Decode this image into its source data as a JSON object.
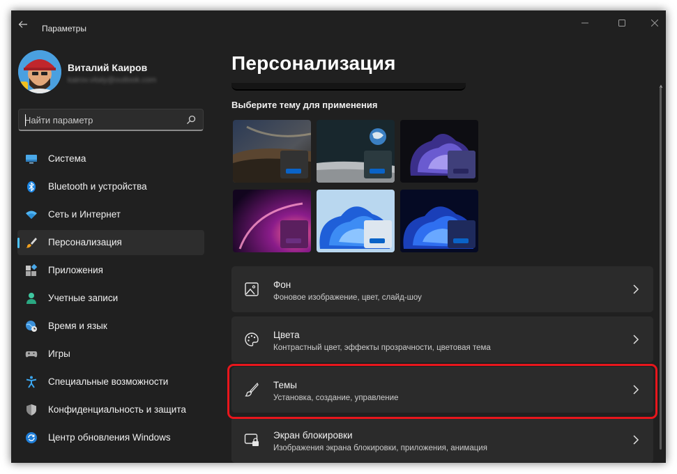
{
  "window": {
    "title": "Параметры"
  },
  "user": {
    "name": "Виталий Каиров",
    "email": "kairov.vitaly@outlook.com"
  },
  "search": {
    "placeholder": "Найти параметр"
  },
  "nav": [
    {
      "label": "Система",
      "icon": "monitor-icon"
    },
    {
      "label": "Bluetooth и устройства",
      "icon": "bluetooth-icon"
    },
    {
      "label": "Сеть и Интернет",
      "icon": "wifi-icon"
    },
    {
      "label": "Персонализация",
      "icon": "brush-icon",
      "active": true
    },
    {
      "label": "Приложения",
      "icon": "apps-icon"
    },
    {
      "label": "Учетные записи",
      "icon": "person-icon"
    },
    {
      "label": "Время и язык",
      "icon": "globe-clock-icon"
    },
    {
      "label": "Игры",
      "icon": "gamepad-icon"
    },
    {
      "label": "Специальные возможности",
      "icon": "accessibility-icon"
    },
    {
      "label": "Конфиденциальность и защита",
      "icon": "shield-icon"
    },
    {
      "label": "Центр обновления Windows",
      "icon": "update-icon"
    }
  ],
  "main": {
    "title": "Персонализация",
    "themes_label": "Выберите тему для применения",
    "cards": [
      {
        "title": "Фон",
        "subtitle": "Фоновое изображение, цвет, слайд-шоу",
        "icon": "image-icon"
      },
      {
        "title": "Цвета",
        "subtitle": "Контрастный цвет, эффекты прозрачности, цветовая тема",
        "icon": "palette-icon"
      },
      {
        "title": "Темы",
        "subtitle": "Установка, создание, управление",
        "icon": "brush-icon"
      },
      {
        "title": "Экран блокировки",
        "subtitle": "Изображения экрана блокировки, приложения, анимация",
        "icon": "lock-screen-icon"
      }
    ]
  },
  "colors": {
    "accent": "#4cc2ff",
    "highlight": "#e8161c",
    "background": "#202020",
    "card": "#2b2b2b"
  }
}
